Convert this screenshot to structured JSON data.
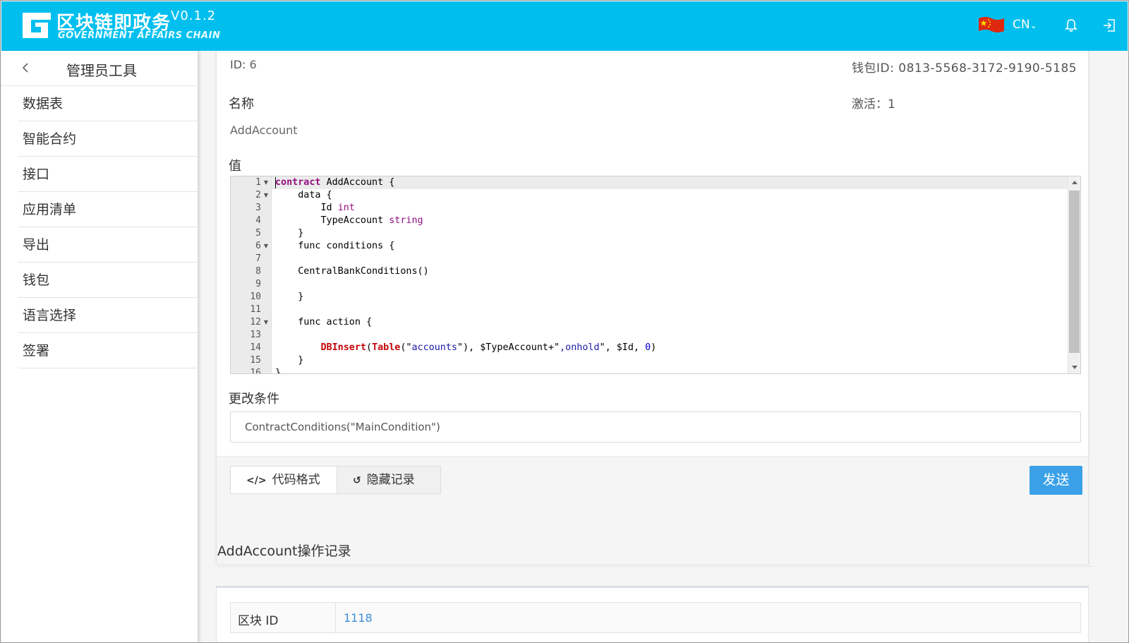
{
  "header": {
    "brand_title": "区块链即政务",
    "brand_subtitle": "GOVERNMENT AFFAIRS CHAIN",
    "version": "V0.1.2",
    "language": "CN",
    "accent_color": "#00bfee"
  },
  "sidebar": {
    "title": "管理员工具",
    "items": [
      {
        "label": "数据表"
      },
      {
        "label": "智能合约"
      },
      {
        "label": "接口"
      },
      {
        "label": "应用清单"
      },
      {
        "label": "导出"
      },
      {
        "label": "钱包"
      },
      {
        "label": "语言选择"
      },
      {
        "label": "签署"
      }
    ]
  },
  "contract": {
    "id_label": "ID:",
    "id_value": "6",
    "wallet_label": "钱包ID:",
    "wallet_value": "0813-5568-3172-9190-5185",
    "name_label": "名称",
    "name_value": "AddAccount",
    "active_label": "激活：",
    "active_value": "1",
    "value_label": "值",
    "code_lines": [
      "contract AddAccount {",
      "    data {",
      "        Id int",
      "        TypeAccount string",
      "    }",
      "    func conditions {",
      "",
      "    CentralBankConditions()",
      "",
      "    }",
      "",
      "    func action {",
      "",
      "        DBInsert(Table(\"accounts\"), $TypeAccount+\",onhold\", $Id, 0)",
      "    }",
      "}"
    ],
    "conditions_label": "更改条件",
    "conditions_value": "ContractConditions(\"MainCondition\")"
  },
  "actions": {
    "format_label": "代码格式",
    "history_label": "隐藏记录",
    "send_label": "发送"
  },
  "history": {
    "title": "AddAccount操作记录",
    "rows": [
      {
        "key": "区块 ID",
        "value": "1118"
      }
    ]
  }
}
